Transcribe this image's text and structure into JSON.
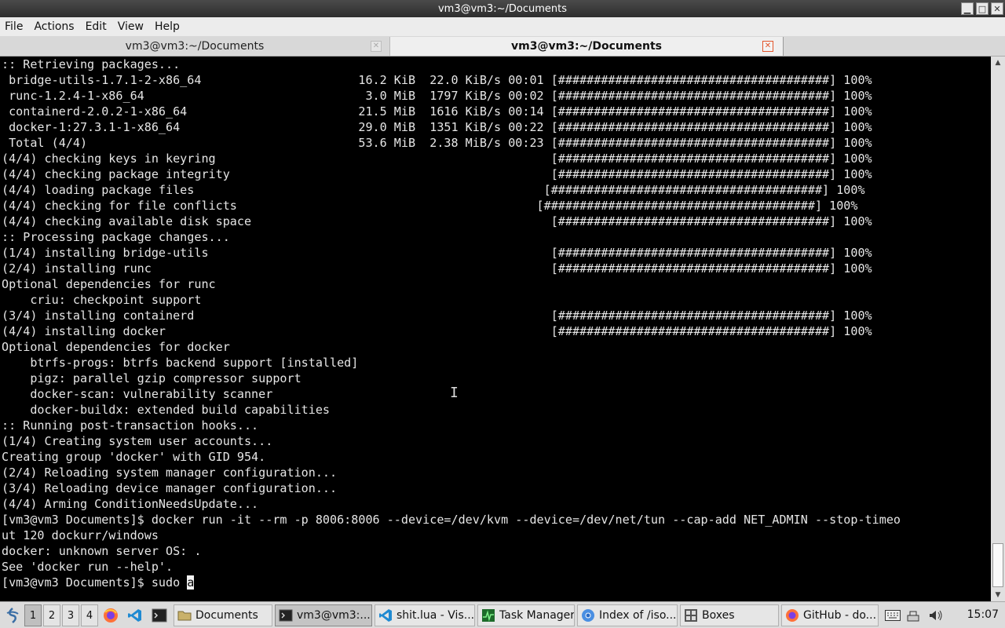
{
  "window": {
    "title": "vm3@vm3:~/Documents"
  },
  "menubar": {
    "items": [
      "File",
      "Actions",
      "Edit",
      "View",
      "Help"
    ]
  },
  "tabs": [
    {
      "label": "vm3@vm3:~/Documents",
      "active": false
    },
    {
      "label": "vm3@vm3:~/Documents",
      "active": true
    }
  ],
  "terminal": {
    "lines": [
      ":: Retrieving packages...",
      " bridge-utils-1.7.1-2-x86_64                      16.2 KiB  22.0 KiB/s 00:01 [######################################] 100%",
      " runc-1.2.4-1-x86_64                               3.0 MiB  1797 KiB/s 00:02 [######################################] 100%",
      " containerd-2.0.2-1-x86_64                        21.5 MiB  1616 KiB/s 00:14 [######################################] 100%",
      " docker-1:27.3.1-1-x86_64                         29.0 MiB  1351 KiB/s 00:22 [######################################] 100%",
      " Total (4/4)                                      53.6 MiB  2.38 MiB/s 00:23 [######################################] 100%",
      "(4/4) checking keys in keyring                                               [######################################] 100%",
      "(4/4) checking package integrity                                             [######################################] 100%",
      "(4/4) loading package files                                                 [######################################] 100%",
      "(4/4) checking for file conflicts                                          [######################################] 100%",
      "(4/4) checking available disk space                                          [######################################] 100%",
      ":: Processing package changes...",
      "(1/4) installing bridge-utils                                                [######################################] 100%",
      "(2/4) installing runc                                                        [######################################] 100%",
      "Optional dependencies for runc",
      "    criu: checkpoint support",
      "(3/4) installing containerd                                                  [######################################] 100%",
      "(4/4) installing docker                                                      [######################################] 100%",
      "Optional dependencies for docker",
      "    btrfs-progs: btrfs backend support [installed]",
      "    pigz: parallel gzip compressor support",
      "    docker-scan: vulnerability scanner",
      "    docker-buildx: extended build capabilities",
      ":: Running post-transaction hooks...",
      "(1/4) Creating system user accounts...",
      "Creating group 'docker' with GID 954.",
      "(2/4) Reloading system manager configuration...",
      "(3/4) Reloading device manager configuration...",
      "(4/4) Arming ConditionNeedsUpdate...",
      "[vm3@vm3 Documents]$ docker run -it --rm -p 8006:8006 --device=/dev/kvm --device=/dev/net/tun --cap-add NET_ADMIN --stop-timeo",
      "ut 120 dockurr/windows",
      "docker: unknown server OS: .",
      "See 'docker run --help'."
    ],
    "prompt": "[vm3@vm3 Documents]$ sudo ",
    "cursor_char": "a"
  },
  "taskbar": {
    "workspaces": [
      "1",
      "2",
      "3",
      "4"
    ],
    "active_workspace": "1",
    "tasks": [
      {
        "label": "Documents",
        "icon": "folder-icon"
      },
      {
        "label": "vm3@vm3:...",
        "icon": "terminal-icon",
        "active": true
      },
      {
        "label": "shit.lua - Vis...",
        "icon": "vscode-icon"
      },
      {
        "label": "Task Manager",
        "icon": "task-manager-icon"
      },
      {
        "label": "Index of /iso...",
        "icon": "chromium-icon"
      },
      {
        "label": "Boxes",
        "icon": "boxes-icon"
      },
      {
        "label": "GitHub - do...",
        "icon": "firefox-icon"
      }
    ],
    "clock": "15:07"
  },
  "colors": {
    "terminal_bg": "#000000",
    "terminal_fg": "#e6e6e6",
    "close_accent": "#e2552b"
  }
}
